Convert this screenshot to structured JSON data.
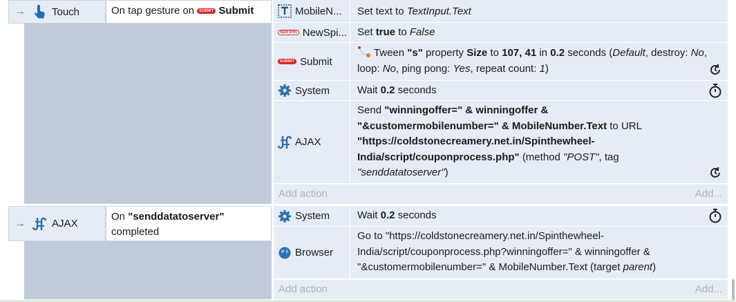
{
  "events": [
    {
      "condition": {
        "object": "Touch",
        "icon": "touch-hand-icon",
        "trigger_prefix": "On tap gesture on",
        "trigger_object": "Submit",
        "trigger_badge": "SUBMIT"
      },
      "actions": [
        {
          "object": "MobileN...",
          "icon": "text-input-icon",
          "text_plain": "Set text to ",
          "text_italic": "TextInput.Text"
        },
        {
          "object": "NewSpi...",
          "icon": "newspin-badge-icon",
          "badge": "NEW SPIN",
          "set": "Set",
          "bold": "true",
          "to": "to",
          "italic": "False"
        },
        {
          "object": "Submit",
          "icon": "submit-badge-icon",
          "badge": "SUBMIT",
          "p1": "Tween",
          "q1": "\"s\"",
          "p2": "property",
          "q2": "Size",
          "p3": "to",
          "q3": "107, 41",
          "p4": "in",
          "q4": "0.2",
          "p5": "seconds (",
          "i1": "Default",
          "p6": ", destroy:",
          "i2": "No",
          "p7": ", loop:",
          "i3": "No",
          "p8": ", ping pong:",
          "i4": "Yes",
          "p9": ", repeat count:",
          "i5": "1",
          "p10": ")"
        },
        {
          "object": "System",
          "icon": "gear-icon",
          "p1": "Wait",
          "q1": "0.2",
          "p2": "seconds"
        },
        {
          "object": "AJAX",
          "icon": "ajax-icon",
          "p1": "Send",
          "q1": "\"winningoffer=\" & winningoffer &",
          "q2": "\"&customermobilenumber=\" & MobileNumber.Text",
          "p2": "to URL",
          "q3": "\"https://coldstonecreamery.net.in/Spinthewheel-",
          "q4": "India/script/couponprocess.php\"",
          "p3": "(method",
          "i1": "\"POST\"",
          "p4": ", tag",
          "i2": "\"senddatatoserver\"",
          "p5": ")"
        }
      ],
      "add_action": "Add action",
      "add_more": "Add..."
    },
    {
      "condition": {
        "object": "AJAX",
        "icon": "ajax-icon",
        "trigger_prefix": "On",
        "trigger_bold": "\"senddatatoserver\"",
        "trigger_suffix": "completed"
      },
      "actions": [
        {
          "object": "System",
          "icon": "gear-icon",
          "p1": "Wait",
          "q1": "0.2",
          "p2": "seconds"
        },
        {
          "object": "Browser",
          "icon": "globe-icon",
          "line1": "Go to \"https://coldstonecreamery.net.in/Spinthewheel-",
          "line2": "India/script/couponprocess.php?winningoffer=\" & winningoffer &",
          "line3a": "\"&customermobilenumber=\" & MobileNumber.Text  (target",
          "line3i": "parent",
          "line3b": ")"
        }
      ],
      "add_action": "Add action",
      "add_more": "Add..."
    }
  ],
  "colors": {
    "row_bg": "#e6ecf5",
    "side_bg": "#bfcbd8",
    "arrow_green": "#1e9e45",
    "badge_red": "#d92626",
    "icon_blue": "#2a6fb0"
  }
}
